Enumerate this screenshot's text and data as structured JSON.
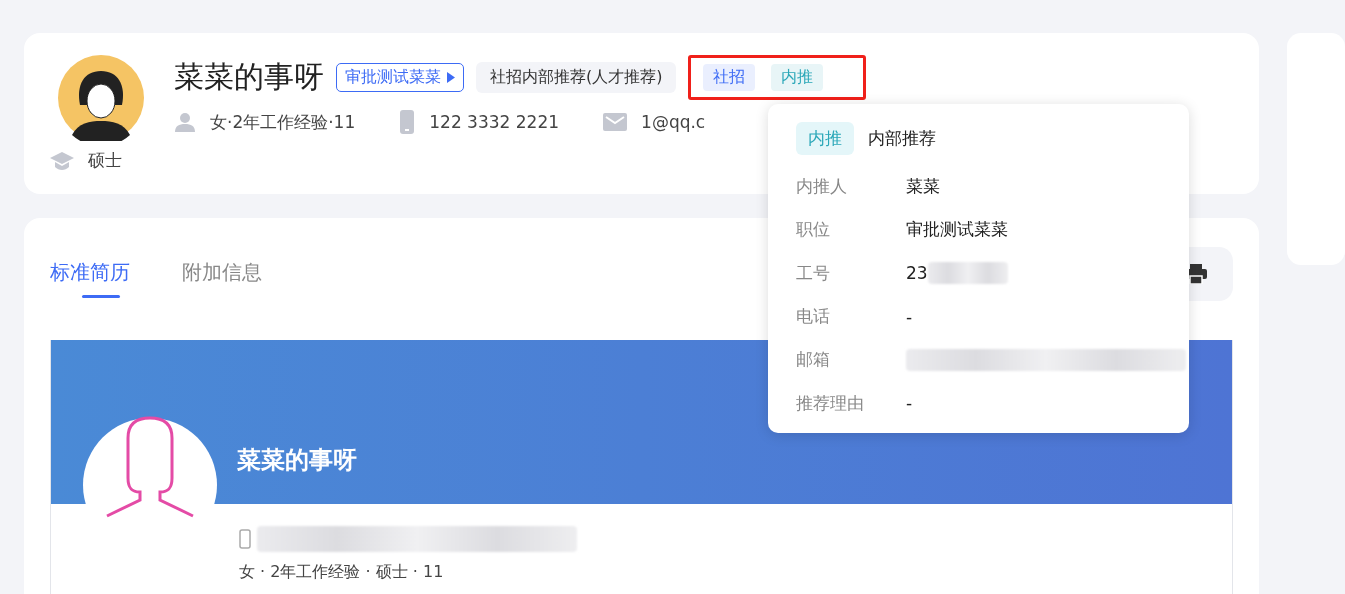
{
  "header": {
    "name": "菜菜的事呀",
    "position_tag": "审批测试菜菜",
    "source_tag": "社招内部推荐(人才推荐)",
    "tags": [
      {
        "label": "社招",
        "color": "#3d6bf5"
      },
      {
        "label": "内推",
        "color": "#2aa7b8"
      }
    ],
    "info": [
      {
        "kind": "person",
        "text": "女·2年工作经验·11"
      },
      {
        "kind": "phone",
        "text": "122 3332 2221"
      },
      {
        "kind": "mail",
        "text": "1@qq.c"
      }
    ],
    "degree": "硕士"
  },
  "tabs": [
    {
      "label": "标准简历",
      "selected": true
    },
    {
      "label": "附加信息",
      "selected": false
    }
  ],
  "resume": {
    "name": "菜菜的事呀",
    "summary": "女 · 2年工作经验 · 硕士 · 11"
  },
  "popover": {
    "tag": "内推",
    "title": "内部推荐",
    "rows": [
      {
        "label": "内推人",
        "value": "菜菜",
        "redacted": false
      },
      {
        "label": "职位",
        "value": "审批测试菜菜",
        "redacted": false
      },
      {
        "label": "工号",
        "value": "23",
        "redacted": true
      },
      {
        "label": "电话",
        "value": "-",
        "redacted": false
      },
      {
        "label": "邮箱",
        "redacted": true
      },
      {
        "label": "推荐理由",
        "value": "-",
        "redacted": false
      }
    ]
  }
}
